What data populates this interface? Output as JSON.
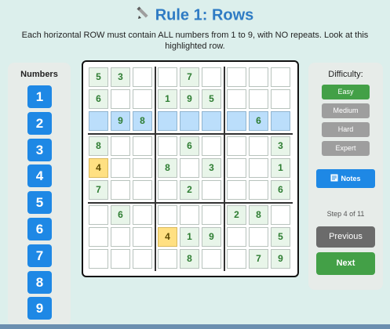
{
  "header": {
    "title": "Rule 1: Rows",
    "subtitle": "Each horizontal ROW must contain ALL numbers from 1 to 9, with NO repeats. Look at this highlighted row.",
    "icon": "pencil-icon"
  },
  "numbers_panel": {
    "title": "Numbers",
    "buttons": [
      "1",
      "2",
      "3",
      "4",
      "5",
      "6",
      "7",
      "8",
      "9"
    ],
    "color": "#1e88e5"
  },
  "grid": {
    "highlighted_row": 3,
    "highlighted_cells": [
      [
        5,
        1
      ],
      [
        8,
        4
      ]
    ],
    "rows": [
      [
        "5",
        "3",
        "",
        "",
        "7",
        "",
        "",
        "",
        ""
      ],
      [
        "6",
        "",
        "",
        "1",
        "9",
        "5",
        "",
        "",
        ""
      ],
      [
        "",
        "9",
        "8",
        "",
        "",
        "",
        "",
        "6",
        ""
      ],
      [
        "8",
        "",
        "",
        "",
        "6",
        "",
        "",
        "",
        "3"
      ],
      [
        "4",
        "",
        "",
        "8",
        "",
        "3",
        "",
        "",
        "1"
      ],
      [
        "7",
        "",
        "",
        "",
        "2",
        "",
        "",
        "",
        "6"
      ],
      [
        "",
        "6",
        "",
        "",
        "",
        "",
        "2",
        "8",
        ""
      ],
      [
        "",
        "",
        "",
        "4",
        "1",
        "9",
        "",
        "",
        "5"
      ],
      [
        "",
        "",
        "",
        "",
        "8",
        "",
        "",
        "7",
        "9"
      ]
    ]
  },
  "controls": {
    "difficulty_label": "Difficulty:",
    "difficulties": [
      "Easy",
      "Medium",
      "Hard",
      "Expert"
    ],
    "selected_difficulty": "Easy",
    "notes_label": "Notes",
    "notes_icon": "memo-icon",
    "step_text": "Step 4 of 11",
    "previous_label": "Previous",
    "next_label": "Next"
  },
  "colors": {
    "accent": "#2e7bc4",
    "given_bg": "#e8f5e9",
    "row_highlight": "#bbdefb",
    "cell_highlight": "#ffe082",
    "next_button": "#43a047",
    "previous_button": "#6b6b6b"
  }
}
